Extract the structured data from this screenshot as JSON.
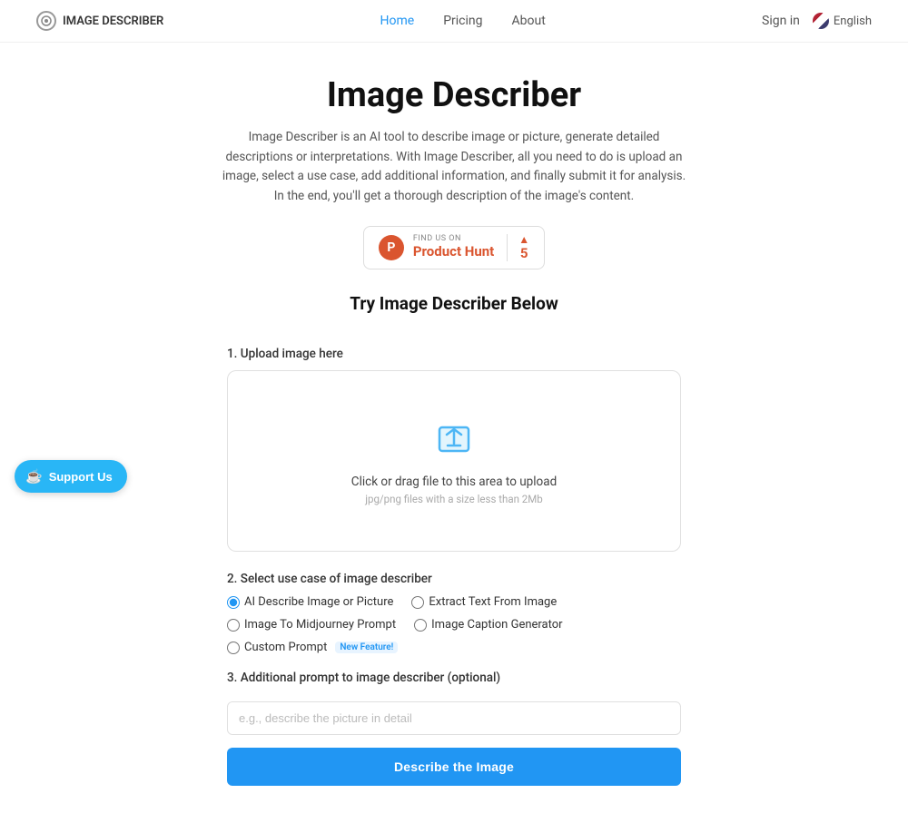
{
  "nav": {
    "logo_text": "IMAGE DESCRIBER",
    "links": [
      {
        "label": "Home",
        "active": true
      },
      {
        "label": "Pricing",
        "active": false
      },
      {
        "label": "About",
        "active": false
      }
    ],
    "sign_in": "Sign in",
    "language": "English"
  },
  "hero": {
    "title": "Image Describer",
    "description": "Image Describer is an AI tool to describe image or picture, generate detailed descriptions or interpretations. With Image Describer, all you need to do is upload an image, select a use case, add additional information, and finally submit it for analysis. In the end, you'll get a thorough description of the image's content.",
    "ph_find_us": "FIND US ON",
    "ph_name": "Product Hunt",
    "ph_score": "5"
  },
  "main": {
    "try_title": "Try Image Describer Below",
    "step1_label": "1. Upload image here",
    "upload_text": "Click or drag file to this area to upload",
    "upload_hint": "jpg/png files with a size less than 2Mb",
    "step2_label": "2. Select use case of image describer",
    "use_cases": [
      {
        "label": "AI Describe Image or Picture",
        "checked": true
      },
      {
        "label": "Extract Text From Image",
        "checked": false
      },
      {
        "label": "Image To Midjourney Prompt",
        "checked": false
      },
      {
        "label": "Image Caption Generator",
        "checked": false
      },
      {
        "label": "Custom Prompt",
        "checked": false,
        "badge": "New Feature!"
      }
    ],
    "step3_label": "3. Additional prompt to image describer (optional)",
    "prompt_placeholder": "e.g., describe the picture in detail",
    "submit_label": "Describe the Image"
  },
  "support": {
    "label": "Support Us"
  }
}
